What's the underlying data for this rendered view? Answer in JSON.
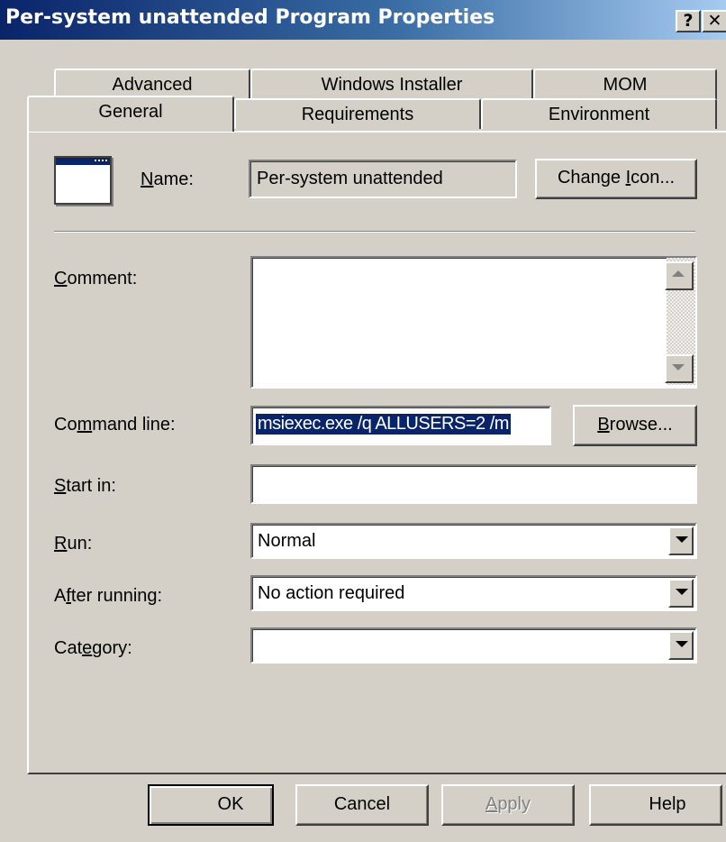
{
  "window": {
    "title": "Per-system unattended Program Properties",
    "help_glyph": "?",
    "close_glyph": "✕"
  },
  "tabs": {
    "row1": [
      "Advanced",
      "Windows Installer",
      "MOM"
    ],
    "row2": [
      "General",
      "Requirements",
      "Environment"
    ],
    "active": "General"
  },
  "general": {
    "name_label": {
      "pre": "",
      "key": "N",
      "post": "ame:"
    },
    "name_value": "Per-system unattended",
    "change_icon": {
      "pre": "Change ",
      "key": "I",
      "post": "con..."
    },
    "comment_label": {
      "pre": "",
      "key": "C",
      "post": "omment:"
    },
    "comment_value": "",
    "command_label": {
      "pre": "Co",
      "key": "m",
      "post": "mand line:"
    },
    "command_value": "msiexec.exe /q ALLUSERS=2 /m ",
    "browse": {
      "pre": "",
      "key": "B",
      "post": "rowse..."
    },
    "start_label": {
      "pre": "",
      "key": "S",
      "post": "tart in:"
    },
    "start_value": "",
    "run_label": {
      "pre": "",
      "key": "R",
      "post": "un:"
    },
    "run_value": "Normal",
    "after_label": {
      "pre": "A",
      "key": "f",
      "post": "ter running:"
    },
    "after_value": "No action required",
    "category_label": {
      "pre": "Cat",
      "key": "e",
      "post": "gory:"
    },
    "category_value": ""
  },
  "buttons": {
    "ok": "OK",
    "cancel": "Cancel",
    "apply": {
      "pre": "",
      "key": "A",
      "post": "pply"
    },
    "help": "Help"
  },
  "colors": {
    "title_start": "#0a246a",
    "title_end": "#a6caf0",
    "selection": "#0a246a",
    "face": "#d4d0c8"
  }
}
